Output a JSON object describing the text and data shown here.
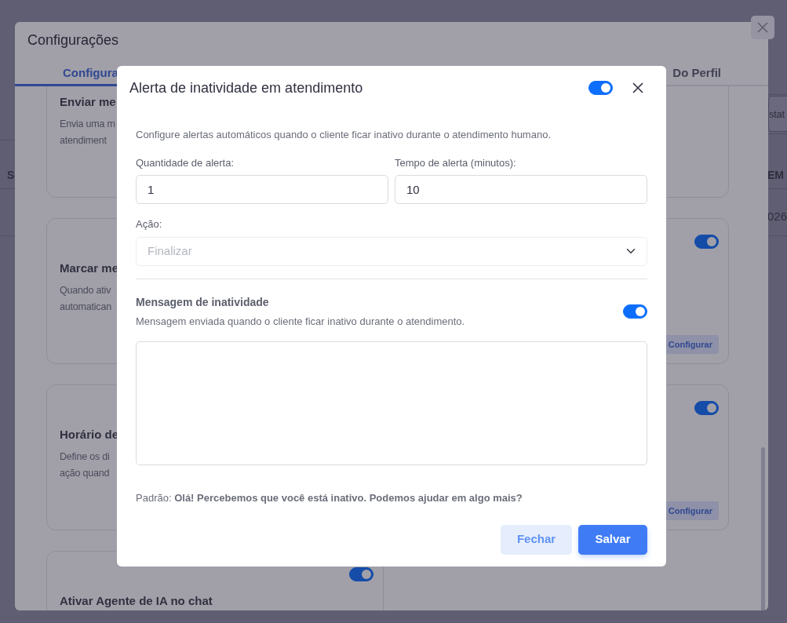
{
  "background_page": {
    "search_placeholder": "stat",
    "column_1": "S",
    "column_2": "EM",
    "cell": "026"
  },
  "settings_modal": {
    "title": "Configurações",
    "tabs": [
      {
        "label": "Configura",
        "selected": true
      },
      {
        "label": "Do Perfil",
        "selected": false
      }
    ],
    "left_cards": [
      {
        "title": "Enviar me",
        "description_lines": [
          "Envia uma m",
          "atendiment"
        ]
      },
      {
        "title": "Marcar me",
        "description_lines": [
          "Quando ativ",
          "automatican"
        ]
      },
      {
        "title": "Horário de",
        "description_lines": [
          "Define os di",
          "ação quand"
        ]
      },
      {
        "title": "Ativar Agente de IA no chat",
        "toggle_on": true
      }
    ],
    "right_cards": [
      {
        "toggle_on": true,
        "button": "Configurar"
      },
      {
        "toggle_on": true,
        "button": "Configurar"
      }
    ]
  },
  "alert_modal": {
    "title": "Alerta de inatividade em atendimento",
    "enabled": true,
    "description": "Configure alertas automáticos quando o cliente ficar inativo durante o atendimento humano.",
    "fields": [
      {
        "label": "Quantidade de alerta:",
        "value": "1"
      },
      {
        "label": "Tempo de alerta (minutos):",
        "value": "10"
      }
    ],
    "action": {
      "label": "Ação:",
      "placeholder": "Finalizar"
    },
    "message_section": {
      "title": "Mensagem de inatividade",
      "subtitle": "Mensagem enviada quando o cliente ficar inativo durante o atendimento.",
      "on": true
    },
    "default_text": "Padrão: **Olá! Percebemos que você está inativo. Podemos ajudar em algo mais?**",
    "buttons": [
      {
        "label": "Fechar",
        "kind": "secondary"
      },
      {
        "label": "Salvar",
        "kind": "primary"
      }
    ]
  }
}
